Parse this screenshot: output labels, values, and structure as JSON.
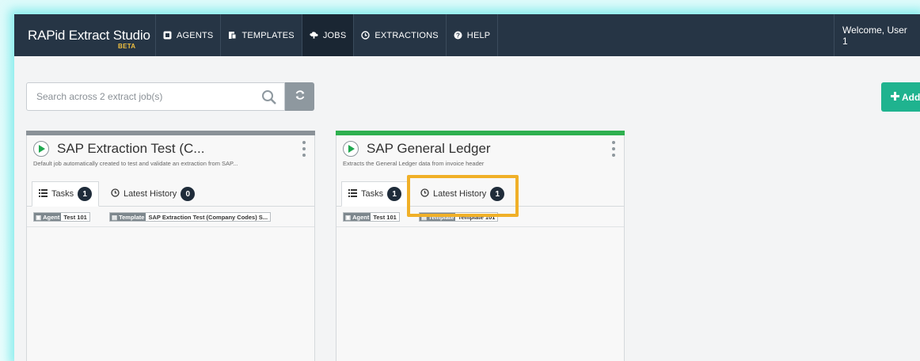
{
  "navbar": {
    "brand": "RAPid Extract Studio",
    "beta": "BETA",
    "items": [
      {
        "label": "AGENTS",
        "icon": "agent-icon"
      },
      {
        "label": "TEMPLATES",
        "icon": "template-icon"
      },
      {
        "label": "JOBS",
        "icon": "jobs-icon",
        "active": true
      },
      {
        "label": "EXTRACTIONS",
        "icon": "clock-icon"
      },
      {
        "label": "HELP",
        "icon": "help-icon"
      }
    ],
    "welcome": "Welcome, User 1"
  },
  "search": {
    "placeholder": "Search across 2 extract job(s)"
  },
  "add_button": {
    "label": "Add"
  },
  "cards": [
    {
      "status_color": "#8a9298",
      "title": "SAP Extraction Test (C...",
      "description": "Default job automatically created to test and validate an extraction from SAP...",
      "tabs": [
        {
          "label": "Tasks",
          "count": "1"
        },
        {
          "label": "Latest History",
          "count": "0"
        }
      ],
      "agent_tag": {
        "key": "Agent",
        "value": "Test 101"
      },
      "template_tag": {
        "key": "Template",
        "value": "SAP Extraction Test (Company Codes) S..."
      }
    },
    {
      "status_color": "#2eb04f",
      "title": "SAP General Ledger",
      "description": "Extracts the General Ledger data from invoice header",
      "tabs": [
        {
          "label": "Tasks",
          "count": "1"
        },
        {
          "label": "Latest History",
          "count": "1"
        }
      ],
      "agent_tag": {
        "key": "Agent",
        "value": "Test 101"
      },
      "template_tag": {
        "key": "Template",
        "value": "Template 101"
      }
    }
  ],
  "colors": {
    "navbar": "#263545",
    "accent_green": "#1fb38f",
    "highlight": "#f0b028"
  }
}
